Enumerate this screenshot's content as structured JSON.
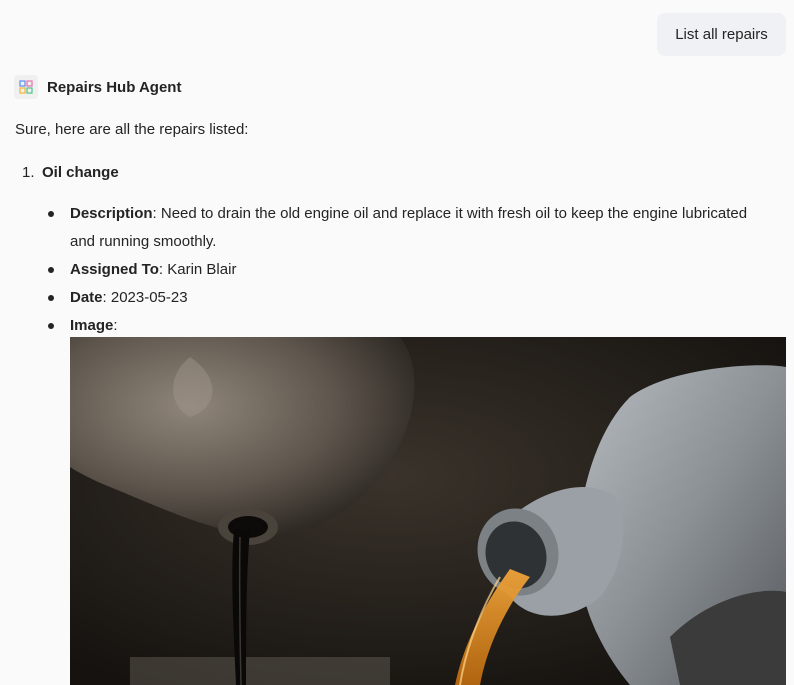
{
  "user_message": "List all repairs",
  "agent": {
    "name": "Repairs Hub Agent",
    "icon": "app-grid-icon"
  },
  "response": {
    "intro": "Sure, here are all the repairs listed:",
    "items": [
      {
        "number": "1.",
        "title": "Oil change",
        "fields": [
          {
            "label": "Description",
            "separator": ":",
            "value": " Need to drain the old engine oil and replace it with fresh oil to keep the engine lubricated and running smoothly."
          },
          {
            "label": "Assigned To",
            "separator": ":",
            "value": " Karin Blair"
          },
          {
            "label": "Date",
            "separator": ":",
            "value": " 2023-05-23"
          },
          {
            "label": "Image",
            "separator": ":",
            "value": ""
          }
        ],
        "image": {
          "kind": "photo",
          "subject": "oil being poured into engine"
        }
      }
    ]
  },
  "colors": {
    "background": "#fafafa",
    "user_bubble": "#f0f1f4",
    "text": "#242424",
    "oil_amber": "#d88a1e",
    "bottle_gray": "#8c9196"
  }
}
